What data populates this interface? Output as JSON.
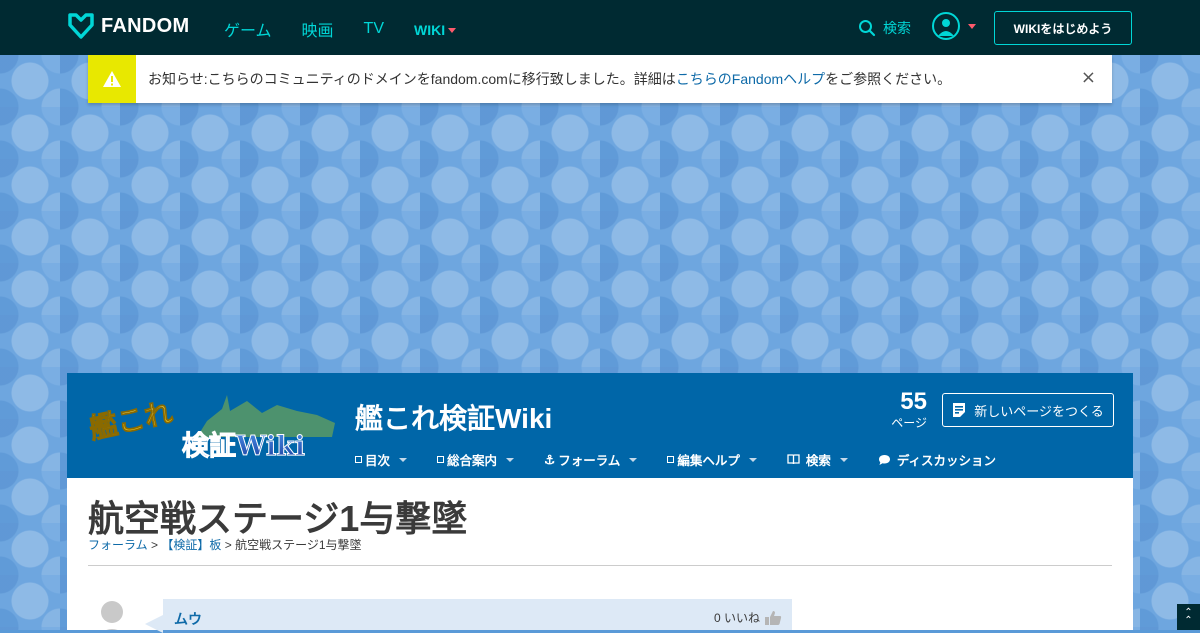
{
  "topnav": {
    "brand": "FANDOM",
    "links": [
      {
        "label": "ゲーム"
      },
      {
        "label": "映画"
      },
      {
        "label": "TV"
      },
      {
        "label": "WIKI"
      }
    ],
    "search_label": "検索",
    "start_wiki_label": "WIKIをはじめよう"
  },
  "notice": {
    "text_before": "お知らせ:こちらのコミュニティのドメインをfandom.comに移行致しました。詳細は",
    "link": "こちらのFandomヘルプ",
    "text_after": "をご参照ください。",
    "close": "×"
  },
  "wiki": {
    "logo_text_1": "艦これ",
    "logo_text_2": "検証Wiki",
    "title": "艦これ検証Wiki",
    "page_count": "55",
    "page_count_label": "ページ",
    "new_page_label": "新しいページをつくる",
    "nav": [
      {
        "label": "目次"
      },
      {
        "label": "総合案内"
      },
      {
        "label": "フォーラム"
      },
      {
        "label": "編集ヘルプ"
      },
      {
        "label": "検索"
      },
      {
        "label": "ディスカッション"
      }
    ]
  },
  "page": {
    "title": "航空戦ステージ1与撃墜",
    "breadcrumb": [
      {
        "label": "フォーラム"
      },
      {
        "label": "【検証】板"
      },
      {
        "label": "航空戦ステージ1与撃墜"
      }
    ],
    "breadcrumb_sep": ">"
  },
  "post": {
    "author": "ムウ",
    "likes": "0 いいね"
  },
  "colors": {
    "topnav_bg": "#002a32",
    "accent": "#00d6d6",
    "wiki_header_bg": "#0066a8",
    "notice_warn": "#e8e800"
  }
}
